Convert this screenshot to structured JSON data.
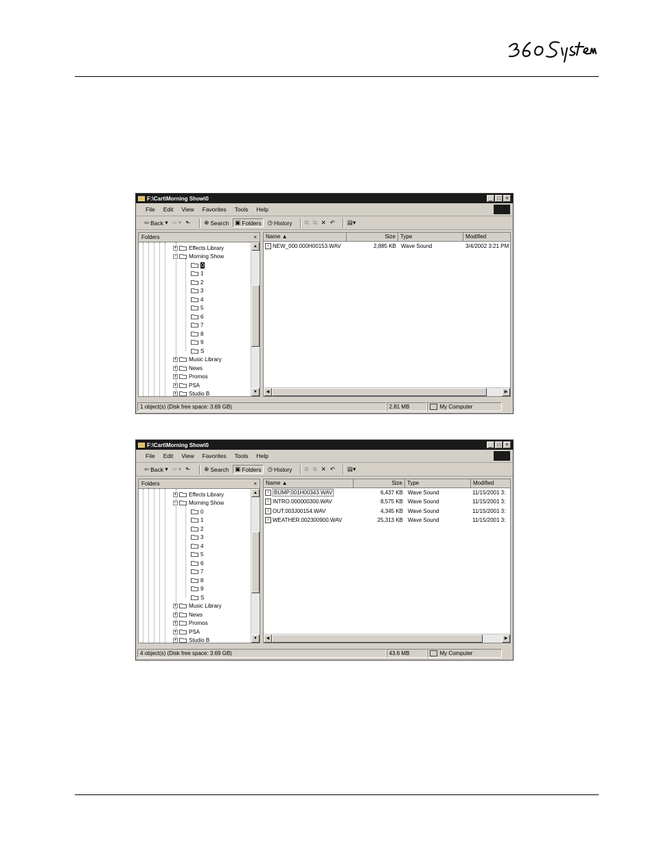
{
  "brand": {
    "logo_text": "360 Systems"
  },
  "windows": [
    {
      "title": "F:\\Cart\\Morning Show\\0",
      "menu": [
        "File",
        "Edit",
        "View",
        "Favorites",
        "Tools",
        "Help"
      ],
      "toolbar": {
        "back": "Back",
        "search": "Search",
        "folders": "Folders",
        "history": "History"
      },
      "folders_label": "Folders",
      "tree": {
        "top_folders": [
          "Effects Library",
          "Morning Show"
        ],
        "subfolders": [
          "0",
          "1",
          "2",
          "3",
          "4",
          "5",
          "6",
          "7",
          "8",
          "9",
          "S"
        ],
        "bottom_folders": [
          "Music Library",
          "News",
          "Promos",
          "PSA",
          "Studio B"
        ],
        "selected": "0"
      },
      "columns": [
        "Name",
        "Size",
        "Type",
        "Modified"
      ],
      "files": [
        {
          "name": "NEW_000.000H00153.WAV",
          "size": "2,885 KB",
          "type": "Wave Sound",
          "modified": "3/4/2002 3:21 PM"
        }
      ],
      "status": {
        "objects": "1 object(s) (Disk free space: 3.69 GB)",
        "size": "2.81 MB",
        "location": "My Computer"
      }
    },
    {
      "title": "F:\\Cart\\Morning Show\\0",
      "menu": [
        "File",
        "Edit",
        "View",
        "Favorites",
        "Tools",
        "Help"
      ],
      "toolbar": {
        "back": "Back",
        "search": "Search",
        "folders": "Folders",
        "history": "History"
      },
      "folders_label": "Folders",
      "tree": {
        "top_folders": [
          "Effects Library",
          "Morning Show"
        ],
        "subfolders": [
          "0",
          "1",
          "2",
          "3",
          "4",
          "5",
          "6",
          "7",
          "8",
          "9",
          "S"
        ],
        "bottom_folders": [
          "Music Library",
          "News",
          "Promos",
          "PSA",
          "Studio B"
        ],
        "selected": ""
      },
      "columns": [
        "Name",
        "Size",
        "Type",
        "Modified"
      ],
      "files": [
        {
          "name": "BUMP.001H00343.WAV",
          "size": "6,437 KB",
          "type": "Wave Sound",
          "modified": "11/15/2001 3:"
        },
        {
          "name": "INTRO.000000300.WAV",
          "size": "8,575 KB",
          "type": "Wave Sound",
          "modified": "11/15/2001 3:"
        },
        {
          "name": "OUT.003J00154.WAV",
          "size": "4,345 KB",
          "type": "Wave Sound",
          "modified": "11/15/2001 3:"
        },
        {
          "name": "WEATHER.002300900.WAV",
          "size": "25,313 KB",
          "type": "Wave Sound",
          "modified": "11/15/2001 3:"
        }
      ],
      "status": {
        "objects": "4 object(s) (Disk free space: 3.69 GB)",
        "size": "43.6 MB",
        "location": "My Computer"
      }
    }
  ]
}
